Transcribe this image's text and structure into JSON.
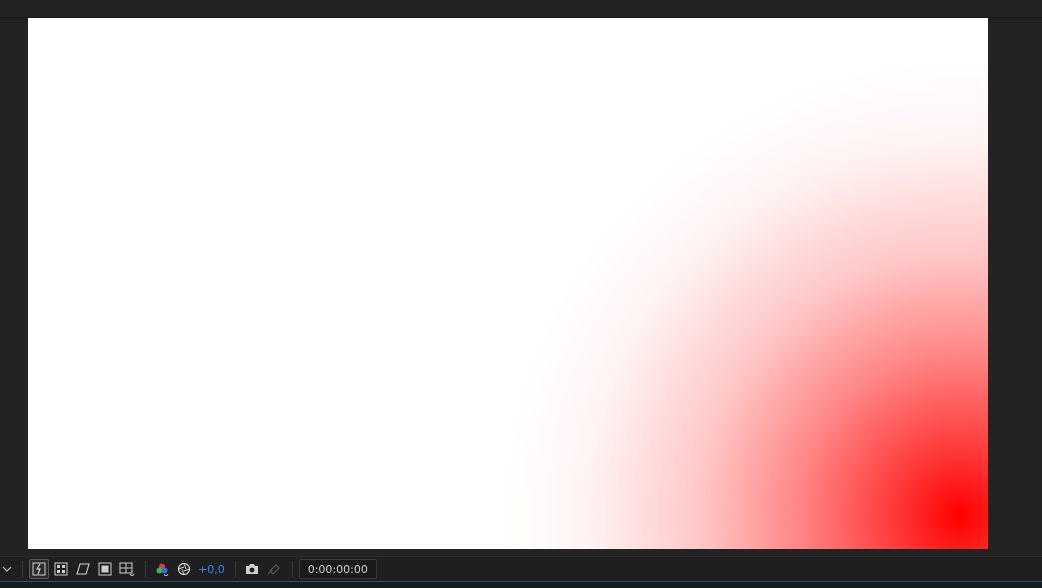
{
  "viewer": {
    "background_color": "#232323",
    "frame_color": "#ffffff",
    "gradient_color": "#ff0000"
  },
  "toolbar": {
    "exposure_value": "+0,0",
    "exposure_color": "#2d8ceb",
    "current_time": "0:00:00:00",
    "icons": [
      "chevron-down-icon",
      "fast-previews-icon",
      "transparency-grid-icon",
      "mask-path-visibility-icon",
      "region-of-interest-icon",
      "grid-guides-icon",
      "show-channel-icon",
      "reset-exposure-icon",
      "snapshot-camera-icon",
      "show-snapshot-icon"
    ]
  }
}
